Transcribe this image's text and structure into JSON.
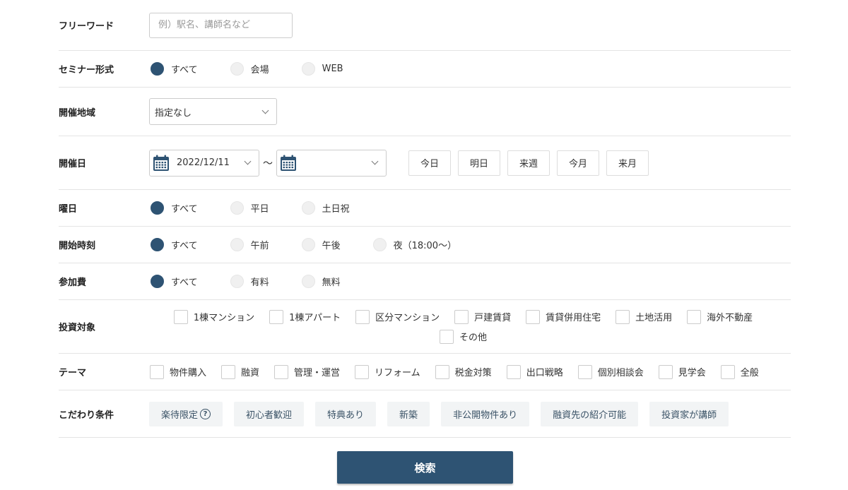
{
  "freeword": {
    "label": "フリーワード",
    "placeholder": "例）駅名、講師名など",
    "value": ""
  },
  "format": {
    "label": "セミナー形式",
    "options": [
      "すべて",
      "会場",
      "WEB"
    ],
    "selected": "すべて"
  },
  "area": {
    "label": "開催地域",
    "selected": "指定なし"
  },
  "date": {
    "label": "開催日",
    "from": "2022/12/11",
    "separator": "〜",
    "to": "",
    "quick": [
      "今日",
      "明日",
      "来週",
      "今月",
      "来月"
    ]
  },
  "dow": {
    "label": "曜日",
    "options": [
      "すべて",
      "平日",
      "土日祝"
    ],
    "selected": "すべて"
  },
  "time": {
    "label": "開始時刻",
    "options": [
      "すべて",
      "午前",
      "午後",
      "夜（18:00〜）"
    ],
    "selected": "すべて"
  },
  "fee": {
    "label": "参加費",
    "options": [
      "すべて",
      "有料",
      "無料"
    ],
    "selected": "すべて"
  },
  "invest": {
    "label": "投資対象",
    "options": [
      "1棟マンション",
      "1棟アパート",
      "区分マンション",
      "戸建賃貸",
      "賃貸併用住宅",
      "土地活用",
      "海外不動産",
      "その他"
    ]
  },
  "theme": {
    "label": "テーマ",
    "options": [
      "物件購入",
      "融資",
      "管理・運営",
      "リフォーム",
      "税金対策",
      "出口戦略",
      "個別相談会",
      "見学会",
      "全般"
    ]
  },
  "pref": {
    "label": "こだわり条件",
    "tags": [
      "楽待限定",
      "初心者歓迎",
      "特典あり",
      "新築",
      "非公開物件あり",
      "融資先の紹介可能",
      "投資家が講師"
    ],
    "help_glyph": "?"
  },
  "search": {
    "label": "検索"
  },
  "colors": {
    "accent": "#2e5373",
    "tag_bg": "#f2f4f5",
    "border": "#e4e4e4"
  }
}
